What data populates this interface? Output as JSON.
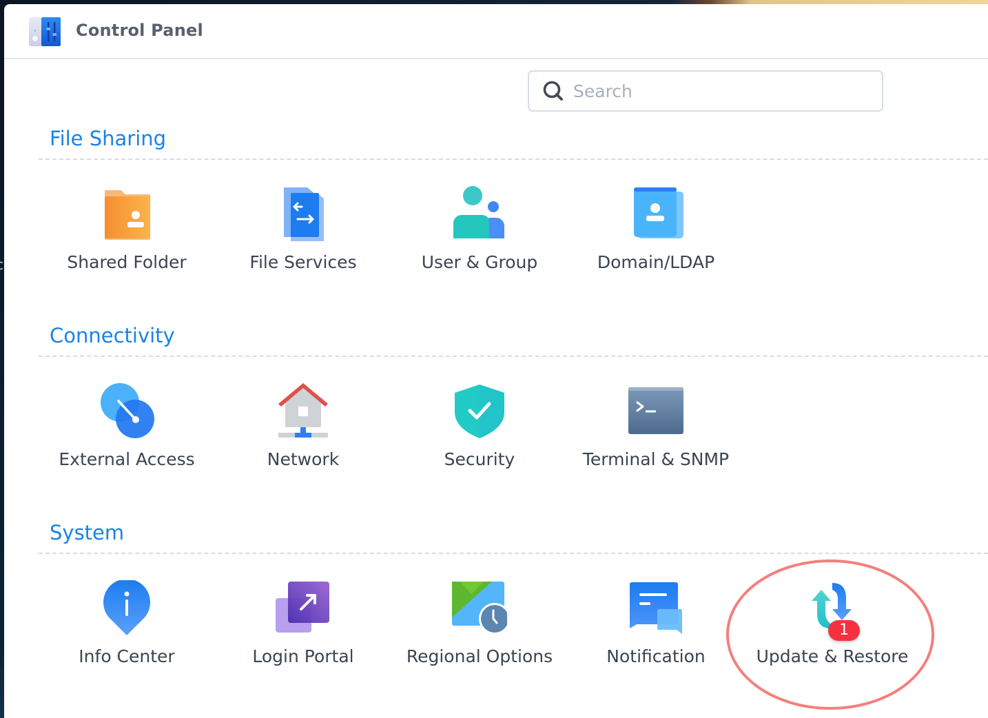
{
  "window": {
    "title": "Control Panel",
    "app_icon": "control-panel-icon"
  },
  "search": {
    "placeholder": "Search",
    "value": "",
    "icon": "search-icon"
  },
  "sections": [
    {
      "title": "File Sharing",
      "items": [
        {
          "label": "Shared Folder",
          "icon": "shared-folder-icon"
        },
        {
          "label": "File Services",
          "icon": "file-services-icon"
        },
        {
          "label": "User & Group",
          "icon": "user-group-icon"
        },
        {
          "label": "Domain/LDAP",
          "icon": "domain-ldap-icon"
        }
      ]
    },
    {
      "title": "Connectivity",
      "items": [
        {
          "label": "External Access",
          "icon": "external-access-icon"
        },
        {
          "label": "Network",
          "icon": "network-icon"
        },
        {
          "label": "Security",
          "icon": "security-shield-icon"
        },
        {
          "label": "Terminal & SNMP",
          "icon": "terminal-icon"
        }
      ]
    },
    {
      "title": "System",
      "items": [
        {
          "label": "Info Center",
          "icon": "info-center-icon"
        },
        {
          "label": "Login Portal",
          "icon": "login-portal-icon"
        },
        {
          "label": "Regional Options",
          "icon": "regional-options-icon"
        },
        {
          "label": "Notification",
          "icon": "notification-icon"
        },
        {
          "label": "Update & Restore",
          "icon": "update-restore-icon",
          "badge": "1"
        }
      ]
    }
  ],
  "annotation": {
    "highlighted_item": "Update & Restore",
    "color": "#f47f7c"
  },
  "colors": {
    "section_title": "#1a82e8",
    "label_text": "#3b4451",
    "badge": "#f4323f"
  }
}
